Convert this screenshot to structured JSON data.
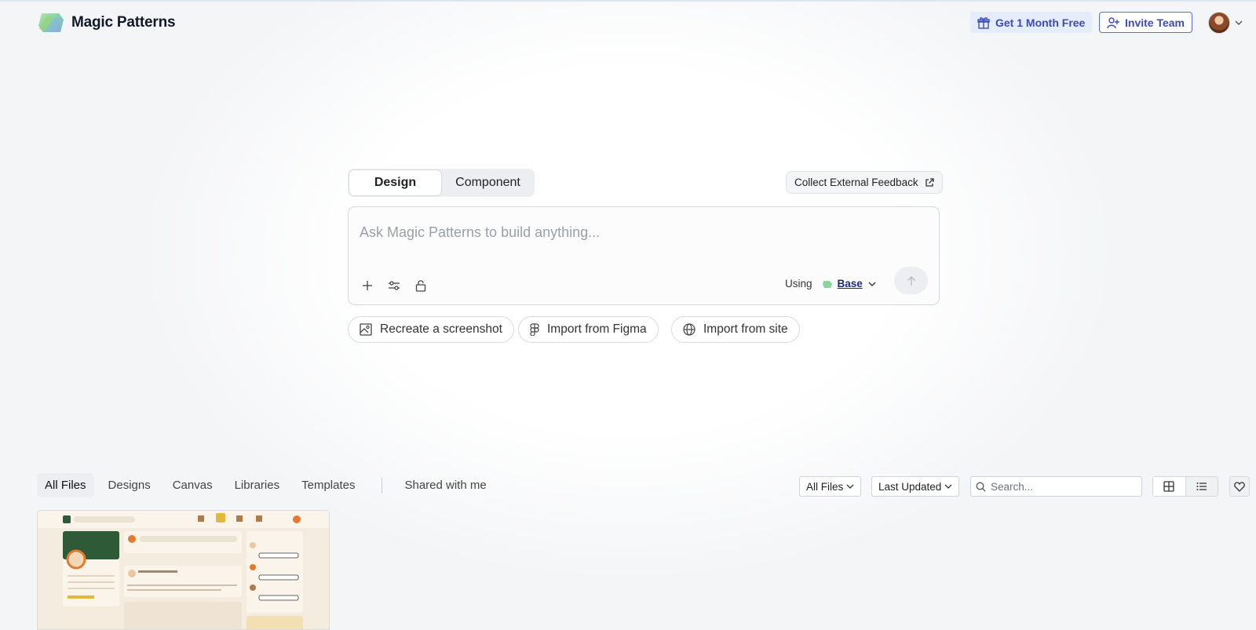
{
  "header": {
    "brand": "Magic Patterns",
    "promo_button": "Get 1 Month Free",
    "invite_button": "Invite Team"
  },
  "composer": {
    "modes": [
      "Design",
      "Component"
    ],
    "active_mode": "Design",
    "feedback_button": "Collect External Feedback",
    "placeholder": "Ask Magic Patterns to build anything...",
    "using_label": "Using",
    "model": "Base"
  },
  "quick_actions": {
    "screenshot": "Recreate a screenshot",
    "figma": "Import from Figma",
    "site": "Import from site"
  },
  "files": {
    "tabs": [
      "All Files",
      "Designs",
      "Canvas",
      "Libraries",
      "Templates"
    ],
    "shared_tab": "Shared with me",
    "active_tab": "All Files",
    "filter": "All Files",
    "sort": "Last Updated",
    "search_placeholder": "Search...",
    "view_mode": "grid"
  },
  "colors": {
    "accent": "#3b4bb8",
    "promo_bg": "#e5ecfb",
    "thumb_bg": "#f4ecdf",
    "thumb_green": "#2f5a37"
  }
}
